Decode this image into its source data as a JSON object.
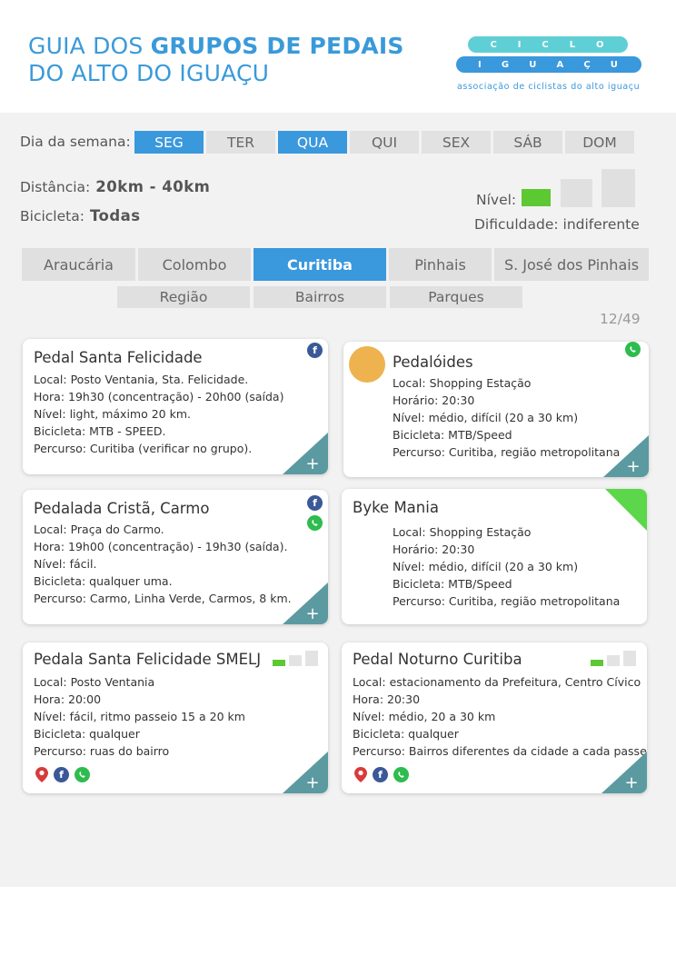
{
  "header": {
    "title_line1_pre": "GUIA DOS ",
    "title_line1_bold": "GRUPOS DE PEDAIS",
    "title_line2": "DO ALTO DO IGUAÇU",
    "logo_top": [
      "C",
      "I",
      "C",
      "L",
      "O"
    ],
    "logo_bottom": [
      "I",
      "G",
      "U",
      "A",
      "Ç",
      "U"
    ],
    "logo_tagline": "associação de ciclistas do alto iguaçu"
  },
  "filters": {
    "day_label": "Dia da semana:",
    "days": [
      {
        "label": "SEG",
        "active": true
      },
      {
        "label": "TER",
        "active": false
      },
      {
        "label": "QUA",
        "active": true
      },
      {
        "label": "QUI",
        "active": false
      },
      {
        "label": "SEX",
        "active": false
      },
      {
        "label": "SÁB",
        "active": false
      },
      {
        "label": "DOM",
        "active": false
      }
    ],
    "distance_label": "Distância:",
    "distance_value": "20km - 40km",
    "bike_label": "Bicicleta:",
    "bike_value": "Todas",
    "level_label": "Nível:",
    "level_selected": 1,
    "level_total": 3,
    "difficulty": "Dificuldade: indiferente"
  },
  "cities": [
    {
      "label": "Araucária",
      "active": false
    },
    {
      "label": "Colombo",
      "active": false
    },
    {
      "label": "Curitiba",
      "active": true
    },
    {
      "label": "Pinhais",
      "active": false
    },
    {
      "label": "S. José dos Pinhais",
      "active": false
    }
  ],
  "subfilters": [
    "Região",
    "Bairros",
    "Parques"
  ],
  "counter": "12/49",
  "cards": [
    {
      "title": "Pedal Santa Felicidade",
      "lines": [
        "Local: Posto Ventania, Sta. Felicidade.",
        "Hora: 19h30 (concentração) - 20h00 (saída)",
        "Nível: light, máximo 20 km.",
        "Bicicleta: MTB - SPEED.",
        "Percurso: Curitiba (verificar no grupo)."
      ]
    },
    {
      "title": "Pedalóides",
      "lines": [
        "Local: Shopping Estação",
        "Horário: 20:30",
        "Nível: médio, difícil (20 a 30 km)",
        "Bicicleta: MTB/Speed",
        "Percurso: Curitiba, região metropolitana"
      ]
    },
    {
      "title": "Pedalada Cristã, Carmo",
      "lines": [
        "Local: Praça do Carmo.",
        "Hora: 19h00 (concentração) - 19h30 (saída).",
        "Nível: fácil.",
        "Bicicleta: qualquer uma.",
        "Percurso: Carmo, Linha Verde, Carmos, 8 km."
      ]
    },
    {
      "title": "Byke Mania",
      "lines": [
        "Local: Shopping Estação",
        "Horário: 20:30",
        "Nível: médio, difícil (20 a 30 km)",
        "Bicicleta: MTB/Speed",
        "Percurso: Curitiba, região metropolitana"
      ]
    },
    {
      "title": "Pedala Santa Felicidade SMELJ",
      "lines": [
        "Local: Posto Ventania",
        "Hora: 20:00",
        "Nível: fácil, ritmo passeio 15 a 20 km",
        "Bicicleta: qualquer",
        "Percurso: ruas do bairro"
      ],
      "level": 1
    },
    {
      "title": "Pedal Noturno Curitiba",
      "lines": [
        "Local: estacionamento da Prefeitura, Centro Cívico",
        "Hora: 20:30",
        "Nível: médio, 20 a 30 km",
        "Bicicleta: qualquer",
        "Percurso: Bairros diferentes da cidade a cada passe"
      ],
      "level": 1
    }
  ],
  "icons": {
    "facebook": "f",
    "plus": "+",
    "colors": {
      "accent": "#3a98dc",
      "teal": "#5b9aa0",
      "green": "#5cc832",
      "facebook": "#3b5998",
      "whatsapp": "#2ebc4f",
      "pin": "#d93a3a",
      "avatar": "#eeb34f"
    }
  }
}
